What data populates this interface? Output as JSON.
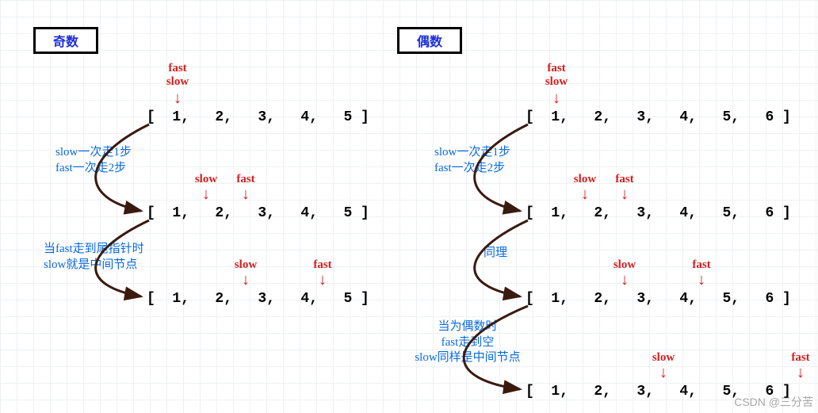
{
  "titles": {
    "odd": "奇数",
    "even": "偶数"
  },
  "ptr": {
    "fast": "fast",
    "slow": "slow"
  },
  "odd": {
    "row1": "[  1,   2,   3,   4,   5 ]",
    "row2": "[  1,   2,   3,   4,   5 ]",
    "row3": "[  1,   2,   3,   4,   5 ]",
    "note1a": "slow一次走1步",
    "note1b": "fast一次走2步",
    "note2a": "当fast走到尾指针时",
    "note2b": "slow就是中间节点"
  },
  "even": {
    "row1": "[  1,   2,   3,   4,   5,   6 ]",
    "row2": "[  1,   2,   3,   4,   5,   6 ]",
    "row3": "[  1,   2,   3,   4,   5,   6 ]",
    "row4": "[  1,   2,   3,   4,   5,   6 ]",
    "note1a": "slow一次走1步",
    "note1b": "fast一次走2步",
    "note2": "同理",
    "note3a": "当为偶数时",
    "note3b": "fast走到空",
    "note3c": "slow同样是中间节点"
  },
  "watermark": "CSDN @三分苦",
  "chart_data": {
    "type": "diagram",
    "title": "Fast & slow pointer linked-list middle demonstration",
    "odd_list": [
      1,
      2,
      3,
      4,
      5
    ],
    "even_list": [
      1,
      2,
      3,
      4,
      5,
      6
    ],
    "odd_steps": [
      {
        "slow_index": 0,
        "fast_index": 0
      },
      {
        "slow_index": 1,
        "fast_index": 2
      },
      {
        "slow_index": 2,
        "fast_index": 4
      }
    ],
    "even_steps": [
      {
        "slow_index": 0,
        "fast_index": 0
      },
      {
        "slow_index": 1,
        "fast_index": 2
      },
      {
        "slow_index": 2,
        "fast_index": 4
      },
      {
        "slow_index": 3,
        "fast_index": null
      }
    ]
  }
}
